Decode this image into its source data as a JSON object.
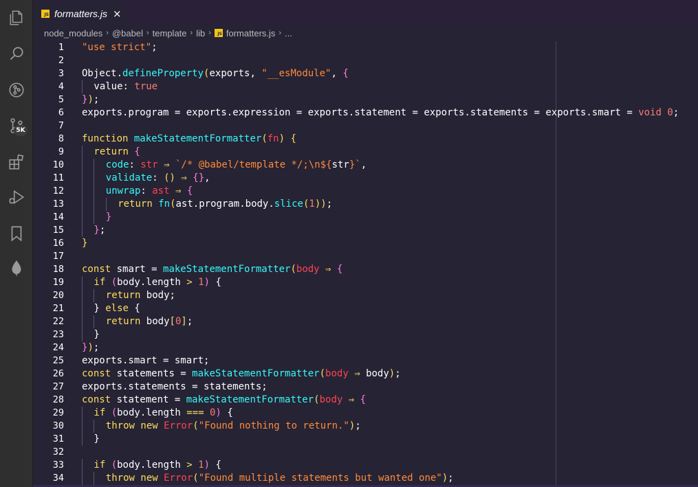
{
  "colors": {
    "background": "#262335",
    "activity_bar": "#2f2f2f",
    "string": "#ff8b39",
    "keyword": "#fede5d",
    "function": "#36f9f6",
    "number": "#f97e72",
    "property": "#ff7edb",
    "js_badge": "#f0c419"
  },
  "activity_bar": {
    "icons": [
      "files-icon",
      "search-icon",
      "source-control-history-icon",
      "source-control-icon",
      "extensions-icon",
      "run-debug-icon",
      "bookmark-icon",
      "leaf-icon"
    ],
    "badge": "5K"
  },
  "tab": {
    "file_icon_text": "JS",
    "title": "formatters.js",
    "close": "×"
  },
  "breadcrumb": {
    "segments": [
      "node_modules",
      "@babel",
      "template",
      "lib",
      "formatters.js",
      "..."
    ],
    "separator": "›"
  },
  "editor": {
    "lines": [
      {
        "n": "1",
        "indent": 0,
        "tokens": [
          [
            "str",
            "\"use strict\""
          ],
          [
            "plain",
            ";"
          ]
        ]
      },
      {
        "n": "2",
        "indent": 0,
        "tokens": []
      },
      {
        "n": "3",
        "indent": 0,
        "tokens": [
          [
            "plain",
            "Object"
          ],
          [
            "plain",
            "."
          ],
          [
            "fn",
            "defineProperty"
          ],
          [
            "kw",
            "("
          ],
          [
            "plain",
            "exports, "
          ],
          [
            "str",
            "\"__esModule\""
          ],
          [
            "plain",
            ", "
          ],
          [
            "prop",
            "{"
          ]
        ]
      },
      {
        "n": "4",
        "indent": 1,
        "tokens": [
          [
            "plain",
            "value"
          ],
          [
            "plain",
            ": "
          ],
          [
            "num",
            "true"
          ]
        ]
      },
      {
        "n": "5",
        "indent": 0,
        "tokens": [
          [
            "prop",
            "}"
          ],
          [
            "kw",
            ")"
          ],
          [
            "plain",
            ";"
          ]
        ]
      },
      {
        "n": "6",
        "indent": 0,
        "tokens": [
          [
            "plain",
            "exports"
          ],
          [
            "plain",
            "."
          ],
          [
            "plain",
            "program"
          ],
          [
            "plain",
            " = exports."
          ],
          [
            "plain",
            "expression"
          ],
          [
            "plain",
            " = exports."
          ],
          [
            "plain",
            "statement"
          ],
          [
            "plain",
            " = exports."
          ],
          [
            "plain",
            "statements"
          ],
          [
            "plain",
            " = exports."
          ],
          [
            "plain",
            "smart"
          ],
          [
            "plain",
            " = "
          ],
          [
            "num",
            "void"
          ],
          [
            "plain",
            " "
          ],
          [
            "num",
            "0"
          ],
          [
            "plain",
            ";"
          ]
        ]
      },
      {
        "n": "7",
        "indent": 0,
        "tokens": []
      },
      {
        "n": "8",
        "indent": 0,
        "tokens": [
          [
            "kw",
            "function"
          ],
          [
            "plain",
            " "
          ],
          [
            "fn",
            "makeStatementFormatter"
          ],
          [
            "kw",
            "("
          ],
          [
            "def",
            "fn"
          ],
          [
            "kw",
            ")"
          ],
          [
            "plain",
            " "
          ],
          [
            "kw",
            "{"
          ]
        ]
      },
      {
        "n": "9",
        "indent": 1,
        "tokens": [
          [
            "kw",
            "return"
          ],
          [
            "plain",
            " "
          ],
          [
            "prop",
            "{"
          ]
        ]
      },
      {
        "n": "10",
        "indent": 2,
        "tokens": [
          [
            "fn",
            "code"
          ],
          [
            "plain",
            ": "
          ],
          [
            "def",
            "str"
          ],
          [
            "plain",
            " "
          ],
          [
            "kw",
            "⇒"
          ],
          [
            "plain",
            " "
          ],
          [
            "str",
            "`/* @babel/template */;\\n${"
          ],
          [
            "plain",
            "str"
          ],
          [
            "str",
            "}`"
          ],
          [
            "plain",
            ","
          ]
        ]
      },
      {
        "n": "11",
        "indent": 2,
        "tokens": [
          [
            "fn",
            "validate"
          ],
          [
            "plain",
            ": "
          ],
          [
            "kw",
            "()"
          ],
          [
            "plain",
            " "
          ],
          [
            "kw",
            "⇒"
          ],
          [
            "plain",
            " "
          ],
          [
            "prop",
            "{}"
          ],
          [
            "plain",
            ","
          ]
        ]
      },
      {
        "n": "12",
        "indent": 2,
        "tokens": [
          [
            "fn",
            "unwrap"
          ],
          [
            "plain",
            ": "
          ],
          [
            "def",
            "ast"
          ],
          [
            "plain",
            " "
          ],
          [
            "kw",
            "⇒"
          ],
          [
            "plain",
            " "
          ],
          [
            "prop",
            "{"
          ]
        ]
      },
      {
        "n": "13",
        "indent": 3,
        "tokens": [
          [
            "kw",
            "return"
          ],
          [
            "plain",
            " "
          ],
          [
            "fn",
            "fn"
          ],
          [
            "kw",
            "("
          ],
          [
            "plain",
            "ast.program.body."
          ],
          [
            "fn",
            "slice"
          ],
          [
            "kw",
            "("
          ],
          [
            "num",
            "1"
          ],
          [
            "kw",
            "))"
          ],
          [
            "plain",
            ";"
          ]
        ]
      },
      {
        "n": "14",
        "indent": 2,
        "tokens": [
          [
            "prop",
            "}"
          ]
        ]
      },
      {
        "n": "15",
        "indent": 1,
        "tokens": [
          [
            "prop",
            "}"
          ],
          [
            "plain",
            ";"
          ]
        ]
      },
      {
        "n": "16",
        "indent": 0,
        "tokens": [
          [
            "kw",
            "}"
          ]
        ]
      },
      {
        "n": "17",
        "indent": 0,
        "tokens": []
      },
      {
        "n": "18",
        "indent": 0,
        "tokens": [
          [
            "kw",
            "const"
          ],
          [
            "plain",
            " smart = "
          ],
          [
            "fn",
            "makeStatementFormatter"
          ],
          [
            "kw",
            "("
          ],
          [
            "def",
            "body"
          ],
          [
            "plain",
            " "
          ],
          [
            "kw",
            "⇒"
          ],
          [
            "plain",
            " "
          ],
          [
            "prop",
            "{"
          ]
        ]
      },
      {
        "n": "19",
        "indent": 1,
        "tokens": [
          [
            "kw",
            "if"
          ],
          [
            "plain",
            " "
          ],
          [
            "prop",
            "("
          ],
          [
            "plain",
            "body.length "
          ],
          [
            "kw",
            ">"
          ],
          [
            "plain",
            " "
          ],
          [
            "num",
            "1"
          ],
          [
            "prop",
            ")"
          ],
          [
            "plain",
            " {"
          ]
        ]
      },
      {
        "n": "20",
        "indent": 2,
        "tokens": [
          [
            "kw",
            "return"
          ],
          [
            "plain",
            " body;"
          ]
        ]
      },
      {
        "n": "21",
        "indent": 1,
        "tokens": [
          [
            "plain",
            "} "
          ],
          [
            "kw",
            "else"
          ],
          [
            "plain",
            " {"
          ]
        ]
      },
      {
        "n": "22",
        "indent": 2,
        "tokens": [
          [
            "kw",
            "return"
          ],
          [
            "plain",
            " body"
          ],
          [
            "kw",
            "["
          ],
          [
            "num",
            "0"
          ],
          [
            "kw",
            "]"
          ],
          [
            "plain",
            ";"
          ]
        ]
      },
      {
        "n": "23",
        "indent": 1,
        "tokens": [
          [
            "plain",
            "}"
          ]
        ]
      },
      {
        "n": "24",
        "indent": 0,
        "tokens": [
          [
            "prop",
            "}"
          ],
          [
            "kw",
            ")"
          ],
          [
            "plain",
            ";"
          ]
        ]
      },
      {
        "n": "25",
        "indent": 0,
        "tokens": [
          [
            "plain",
            "exports.smart = smart;"
          ]
        ]
      },
      {
        "n": "26",
        "indent": 0,
        "tokens": [
          [
            "kw",
            "const"
          ],
          [
            "plain",
            " statements = "
          ],
          [
            "fn",
            "makeStatementFormatter"
          ],
          [
            "kw",
            "("
          ],
          [
            "def",
            "body"
          ],
          [
            "plain",
            " "
          ],
          [
            "kw",
            "⇒"
          ],
          [
            "plain",
            " body"
          ],
          [
            "kw",
            ")"
          ],
          [
            "plain",
            ";"
          ]
        ]
      },
      {
        "n": "27",
        "indent": 0,
        "tokens": [
          [
            "plain",
            "exports.statements = statements;"
          ]
        ]
      },
      {
        "n": "28",
        "indent": 0,
        "tokens": [
          [
            "kw",
            "const"
          ],
          [
            "plain",
            " statement = "
          ],
          [
            "fn",
            "makeStatementFormatter"
          ],
          [
            "kw",
            "("
          ],
          [
            "def",
            "body"
          ],
          [
            "plain",
            " "
          ],
          [
            "kw",
            "⇒"
          ],
          [
            "plain",
            " "
          ],
          [
            "prop",
            "{"
          ]
        ]
      },
      {
        "n": "29",
        "indent": 1,
        "tokens": [
          [
            "kw",
            "if"
          ],
          [
            "plain",
            " "
          ],
          [
            "prop",
            "("
          ],
          [
            "plain",
            "body.length "
          ],
          [
            "kw",
            "==="
          ],
          [
            "plain",
            " "
          ],
          [
            "num",
            "0"
          ],
          [
            "prop",
            ")"
          ],
          [
            "plain",
            " {"
          ]
        ]
      },
      {
        "n": "30",
        "indent": 2,
        "tokens": [
          [
            "kw",
            "throw"
          ],
          [
            "plain",
            " "
          ],
          [
            "kw",
            "new"
          ],
          [
            "plain",
            " "
          ],
          [
            "def",
            "Error"
          ],
          [
            "kw",
            "("
          ],
          [
            "str",
            "\"Found nothing to return.\""
          ],
          [
            "kw",
            ")"
          ],
          [
            "plain",
            ";"
          ]
        ]
      },
      {
        "n": "31",
        "indent": 1,
        "tokens": [
          [
            "plain",
            "}"
          ]
        ]
      },
      {
        "n": "32",
        "indent": 0,
        "tokens": []
      },
      {
        "n": "33",
        "indent": 1,
        "tokens": [
          [
            "kw",
            "if"
          ],
          [
            "plain",
            " "
          ],
          [
            "prop",
            "("
          ],
          [
            "plain",
            "body.length "
          ],
          [
            "kw",
            ">"
          ],
          [
            "plain",
            " "
          ],
          [
            "num",
            "1"
          ],
          [
            "prop",
            ")"
          ],
          [
            "plain",
            " {"
          ]
        ]
      },
      {
        "n": "34",
        "indent": 2,
        "tokens": [
          [
            "kw",
            "throw"
          ],
          [
            "plain",
            " "
          ],
          [
            "kw",
            "new"
          ],
          [
            "plain",
            " "
          ],
          [
            "def",
            "Error"
          ],
          [
            "kw",
            "("
          ],
          [
            "str",
            "\"Found multiple statements but wanted one\""
          ],
          [
            "kw",
            ")"
          ],
          [
            "plain",
            ";"
          ]
        ]
      }
    ]
  }
}
